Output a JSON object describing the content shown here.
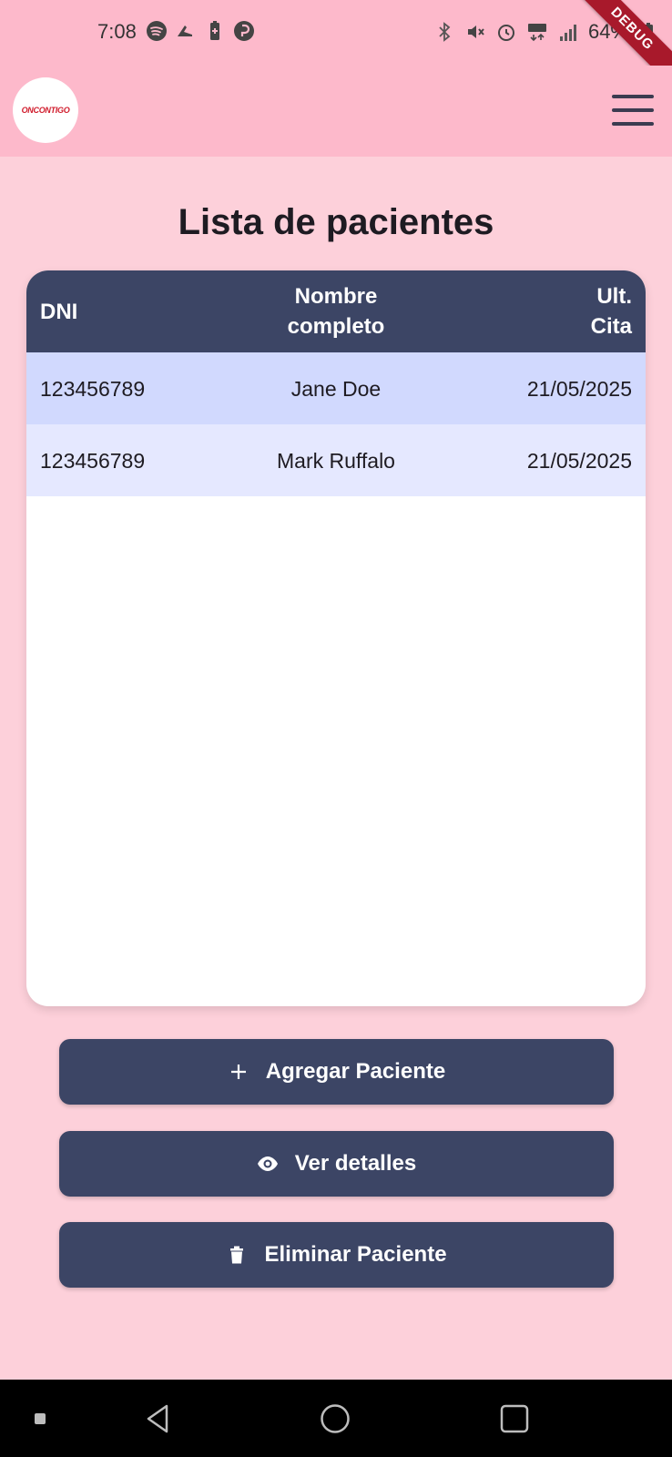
{
  "status_bar": {
    "time": "7:08",
    "battery_percent": "64%",
    "left_icons": [
      "spotify-icon",
      "running-shoe-icon",
      "battery-saver-icon",
      "p-app-icon"
    ],
    "right_icons": [
      "bluetooth-icon",
      "mute-icon",
      "alarm-icon",
      "4g-data-icon",
      "signal-icon",
      "battery-icon"
    ]
  },
  "debug_banner": "DEBUG",
  "app_bar": {
    "logo_text": "ONCONTIGO",
    "menu_icon": "hamburger-menu-icon"
  },
  "page": {
    "title": "Lista de pacientes"
  },
  "table": {
    "headers": {
      "dni": "DNI",
      "name_line1": "Nombre",
      "name_line2": "completo",
      "date_line1": "Ult.",
      "date_line2": "Cita"
    },
    "rows": [
      {
        "dni": "123456789",
        "name": "Jane Doe",
        "date": "21/05/2025"
      },
      {
        "dni": "123456789",
        "name": "Mark Ruffalo",
        "date": "21/05/2025"
      }
    ]
  },
  "actions": {
    "add": {
      "label": "Agregar Paciente",
      "icon": "plus-icon"
    },
    "view": {
      "label": "Ver detalles",
      "icon": "eye-icon"
    },
    "delete": {
      "label": "Eliminar Paciente",
      "icon": "trash-icon"
    }
  },
  "colors": {
    "app_bar": "#fdb9cb",
    "background": "#fdd0da",
    "primary": "#3c4565",
    "row_selected": "#d1d9fe",
    "row_alt": "#e5e8ff",
    "debug": "#a8192b"
  }
}
